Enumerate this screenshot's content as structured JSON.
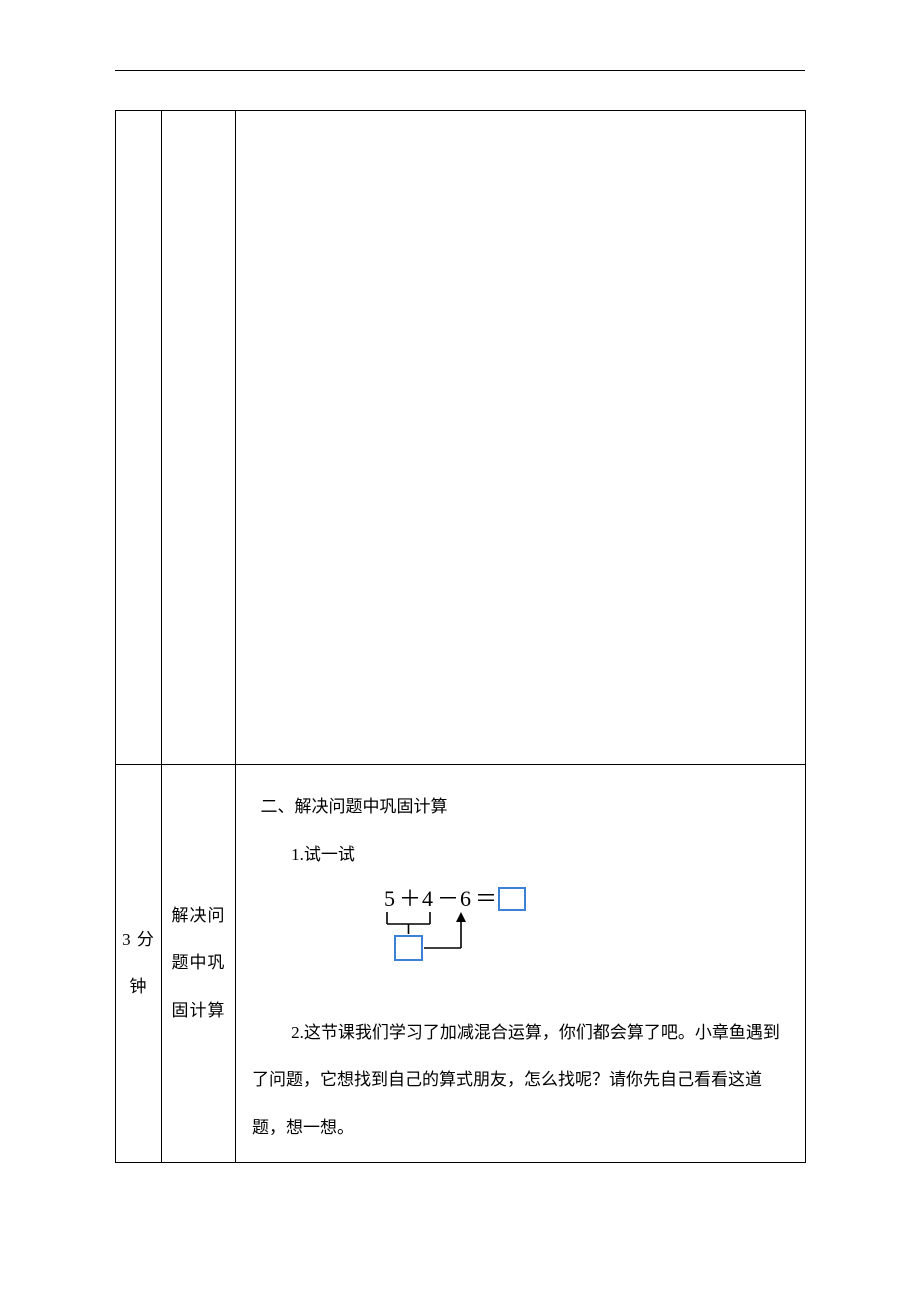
{
  "row2": {
    "col1": "3 分钟",
    "col2": "解决问题中巩固计算",
    "body": {
      "heading": "二、解决问题中巩固计算",
      "item1": "1.试一试",
      "item2": "2.这节课我们学习了加减混合运算，你们都会算了吧。小章鱼遇到了问题，它想找到自己的算式朋友，怎么找呢？请你先自己看看这道题，想一想。"
    }
  },
  "diagram": {
    "expr_a": "5",
    "expr_plus": "＋",
    "expr_b": "4",
    "expr_minus": "－",
    "expr_c": "6",
    "expr_eq": "＝"
  }
}
